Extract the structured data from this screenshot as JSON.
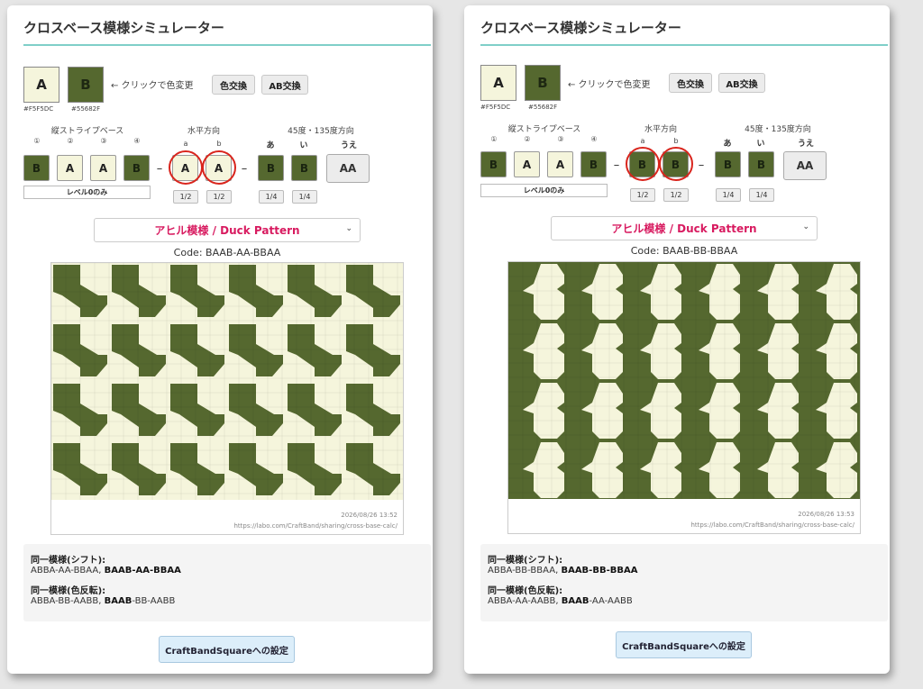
{
  "colors": {
    "a": "#F5F5DC",
    "b": "#55682F",
    "ring": "#d9251d",
    "title_line": "#7fcfc8",
    "pattern_accent": "#d81b60"
  },
  "panels": [
    {
      "title": "クロスベース模様シミュレーター",
      "swatch_a": {
        "label": "A",
        "hex": "#F5F5DC"
      },
      "swatch_b": {
        "label": "B",
        "hex": "#55682F"
      },
      "click_hint": "← クリックで色変更",
      "btn_color_swap": "色交換",
      "btn_ab_swap": "AB交換",
      "vertical": {
        "label": "縦ストライプベース",
        "numbers": [
          "①",
          "②",
          "③",
          "④"
        ],
        "cells": [
          "B",
          "A",
          "A",
          "B"
        ],
        "level_label": "レベル0のみ"
      },
      "horizontal": {
        "label": "水平方向",
        "subs": [
          "a",
          "b"
        ],
        "cells": [
          "A",
          "A"
        ],
        "fractions": [
          "1/2",
          "1/2"
        ]
      },
      "diagonal": {
        "label": "45度・135度方向",
        "subs": [
          "あ",
          "い",
          "うえ"
        ],
        "cells": [
          "B",
          "B"
        ],
        "combo": "AA",
        "fractions": [
          "1/4",
          "1/4"
        ]
      },
      "pattern_name": "アヒル模様 / Duck Pattern",
      "code": "Code: BAAB-AA-BBAA",
      "pattern_variant": "light",
      "timestamp": "2026/08/26 13:52",
      "url": "https://labo.com/CraftBand/sharing/cross-base-calc/",
      "same_shift_label": "同一模様(シフト):",
      "same_shift_plain": "ABBA-AA-BBAA, ",
      "same_shift_bold": "BAAB-AA-BBAA",
      "same_invert_label": "同一模様(色反転):",
      "same_invert_plain1": "ABBA-BB-AABB, ",
      "same_invert_bold": "BAAB",
      "same_invert_plain2": "-BB-AABB",
      "cbs_button": "CraftBandSquareへの設定"
    },
    {
      "title": "クロスベース模様シミュレーター",
      "swatch_a": {
        "label": "A",
        "hex": "#F5F5DC"
      },
      "swatch_b": {
        "label": "B",
        "hex": "#55682F"
      },
      "click_hint": "← クリックで色変更",
      "btn_color_swap": "色交換",
      "btn_ab_swap": "AB交換",
      "vertical": {
        "label": "縦ストライプベース",
        "numbers": [
          "①",
          "②",
          "③",
          "④"
        ],
        "cells": [
          "B",
          "A",
          "A",
          "B"
        ],
        "level_label": "レベル0のみ"
      },
      "horizontal": {
        "label": "水平方向",
        "subs": [
          "a",
          "b"
        ],
        "cells": [
          "B",
          "B"
        ],
        "fractions": [
          "1/2",
          "1/2"
        ]
      },
      "diagonal": {
        "label": "45度・135度方向",
        "subs": [
          "あ",
          "い",
          "うえ"
        ],
        "cells": [
          "B",
          "B"
        ],
        "combo": "AA",
        "fractions": [
          "1/4",
          "1/4"
        ]
      },
      "pattern_name": "アヒル模様 / Duck Pattern",
      "code": "Code: BAAB-BB-BBAA",
      "pattern_variant": "dark",
      "timestamp": "2026/08/26 13:53",
      "url": "https://labo.com/CraftBand/sharing/cross-base-calc/",
      "same_shift_label": "同一模様(シフト):",
      "same_shift_plain": "ABBA-BB-BBAA, ",
      "same_shift_bold": "BAAB-BB-BBAA",
      "same_invert_label": "同一模様(色反転):",
      "same_invert_plain1": "ABBA-AA-AABB, ",
      "same_invert_bold": "BAAB",
      "same_invert_plain2": "-AA-AABB",
      "cbs_button": "CraftBandSquareへの設定"
    }
  ]
}
